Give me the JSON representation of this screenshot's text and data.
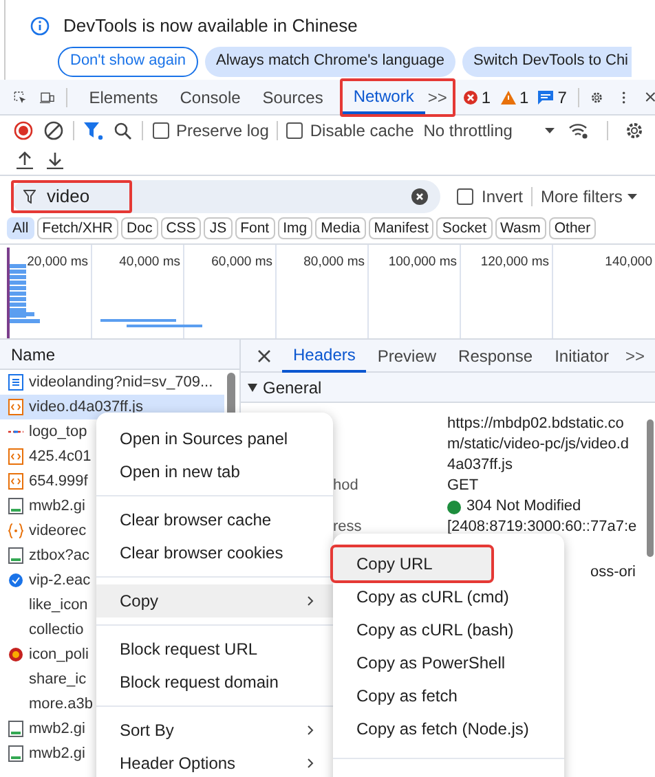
{
  "info_bar": {
    "message": "DevTools is now available in Chinese",
    "buttons": [
      {
        "label": "Don't show again",
        "kind": "outline"
      },
      {
        "label": "Always match Chrome's language",
        "kind": "filled"
      },
      {
        "label": "Switch DevTools to Chi",
        "kind": "filled"
      }
    ]
  },
  "tabs": [
    {
      "label": "Elements",
      "selected": false
    },
    {
      "label": "Console",
      "selected": false
    },
    {
      "label": "Sources",
      "selected": false
    },
    {
      "label": "Network",
      "selected": true
    }
  ],
  "tabs_highlighted": true,
  "more_tabs": ">>",
  "counts": {
    "errors": "1",
    "warnings": "1",
    "messages": "7"
  },
  "toolbar": {
    "preserve_log": {
      "label": "Preserve log",
      "checked": false
    },
    "disable_cache": {
      "label": "Disable cache",
      "checked": false
    },
    "throttling": "No throttling"
  },
  "filter": {
    "value": "video",
    "highlighted": true,
    "invert": {
      "label": "Invert",
      "checked": false
    },
    "more_filters": "More filters"
  },
  "types": [
    {
      "label": "All",
      "selected": true
    },
    {
      "label": "Fetch/XHR",
      "selected": false
    },
    {
      "label": "Doc",
      "selected": false
    },
    {
      "label": "CSS",
      "selected": false
    },
    {
      "label": "JS",
      "selected": false
    },
    {
      "label": "Font",
      "selected": false
    },
    {
      "label": "Img",
      "selected": false
    },
    {
      "label": "Media",
      "selected": false
    },
    {
      "label": "Manifest",
      "selected": false
    },
    {
      "label": "Socket",
      "selected": false
    },
    {
      "label": "Wasm",
      "selected": false
    },
    {
      "label": "Other",
      "selected": false
    }
  ],
  "timeline_ticks": [
    "20,000 ms",
    "40,000 ms",
    "60,000 ms",
    "80,000 ms",
    "100,000 ms",
    "120,000 ms",
    "140,000"
  ],
  "requests": {
    "header": "Name",
    "rows": [
      {
        "name": "videolanding?nid=sv_709...",
        "kind": "document",
        "selected": false
      },
      {
        "name": "video.d4a037ff.js",
        "kind": "script",
        "selected": true
      },
      {
        "name": "logo_top",
        "kind": "xhr",
        "selected": false
      },
      {
        "name": "425.4c01",
        "kind": "script",
        "selected": false
      },
      {
        "name": "654.999f",
        "kind": "script",
        "selected": false
      },
      {
        "name": "mwb2.gi",
        "kind": "image",
        "selected": false
      },
      {
        "name": "videorec",
        "kind": "json",
        "selected": false
      },
      {
        "name": "ztbox?ac",
        "kind": "image",
        "selected": false
      },
      {
        "name": "vip-2.eac",
        "kind": "badge",
        "selected": false
      },
      {
        "name": "like_icon",
        "kind": "blank",
        "selected": false
      },
      {
        "name": "collectio",
        "kind": "blank",
        "selected": false
      },
      {
        "name": "icon_poli",
        "kind": "emblem",
        "selected": false
      },
      {
        "name": "share_ic",
        "kind": "blank",
        "selected": false
      },
      {
        "name": "more.a3b",
        "kind": "blank",
        "selected": false
      },
      {
        "name": "mwb2.gi",
        "kind": "image",
        "selected": false
      },
      {
        "name": "mwb2.gi",
        "kind": "image",
        "selected": false
      }
    ]
  },
  "detail": {
    "tabs": [
      {
        "label": "Headers",
        "selected": true
      },
      {
        "label": "Preview",
        "selected": false
      },
      {
        "label": "Response",
        "selected": false
      },
      {
        "label": "Initiator",
        "selected": false
      }
    ],
    "more_tabs": ">>",
    "section": "General",
    "rows": [
      {
        "label": "",
        "value": "https://mbdp02.bdstatic.com/static/video-pc/js/video.d4a037ff.js",
        "kind": "text"
      },
      {
        "label": "hod",
        "value": "GET",
        "kind": "text"
      },
      {
        "label": "",
        "value": "304 Not Modified",
        "kind": "status"
      },
      {
        "label": "ress",
        "value": "[2408:8719:3000:60::77a7:e",
        "kind": "text"
      },
      {
        "label": "",
        "value": "oss-ori",
        "kind": "right"
      }
    ]
  },
  "context_menu": {
    "groups": [
      [
        {
          "label": "Open in Sources panel",
          "submenu": false,
          "selected": false
        },
        {
          "label": "Open in new tab",
          "submenu": false,
          "selected": false
        }
      ],
      [
        {
          "label": "Clear browser cache",
          "submenu": false,
          "selected": false
        },
        {
          "label": "Clear browser cookies",
          "submenu": false,
          "selected": false
        }
      ],
      [
        {
          "label": "Copy",
          "submenu": true,
          "selected": true
        }
      ],
      [
        {
          "label": "Block request URL",
          "submenu": false,
          "selected": false
        },
        {
          "label": "Block request domain",
          "submenu": false,
          "selected": false
        }
      ],
      [
        {
          "label": "Sort By",
          "submenu": true,
          "selected": false
        },
        {
          "label": "Header Options",
          "submenu": true,
          "selected": false
        }
      ]
    ]
  },
  "submenu": [
    {
      "label": "Copy URL",
      "selected": true,
      "highlighted": true
    },
    {
      "label": "Copy as cURL (cmd)",
      "selected": false,
      "highlighted": false
    },
    {
      "label": "Copy as cURL (bash)",
      "selected": false,
      "highlighted": false
    },
    {
      "label": "Copy as PowerShell",
      "selected": false,
      "highlighted": false
    },
    {
      "label": "Copy as fetch",
      "selected": false,
      "highlighted": false
    },
    {
      "label": "Copy as fetch (Node.js)",
      "selected": false,
      "highlighted": false
    }
  ]
}
